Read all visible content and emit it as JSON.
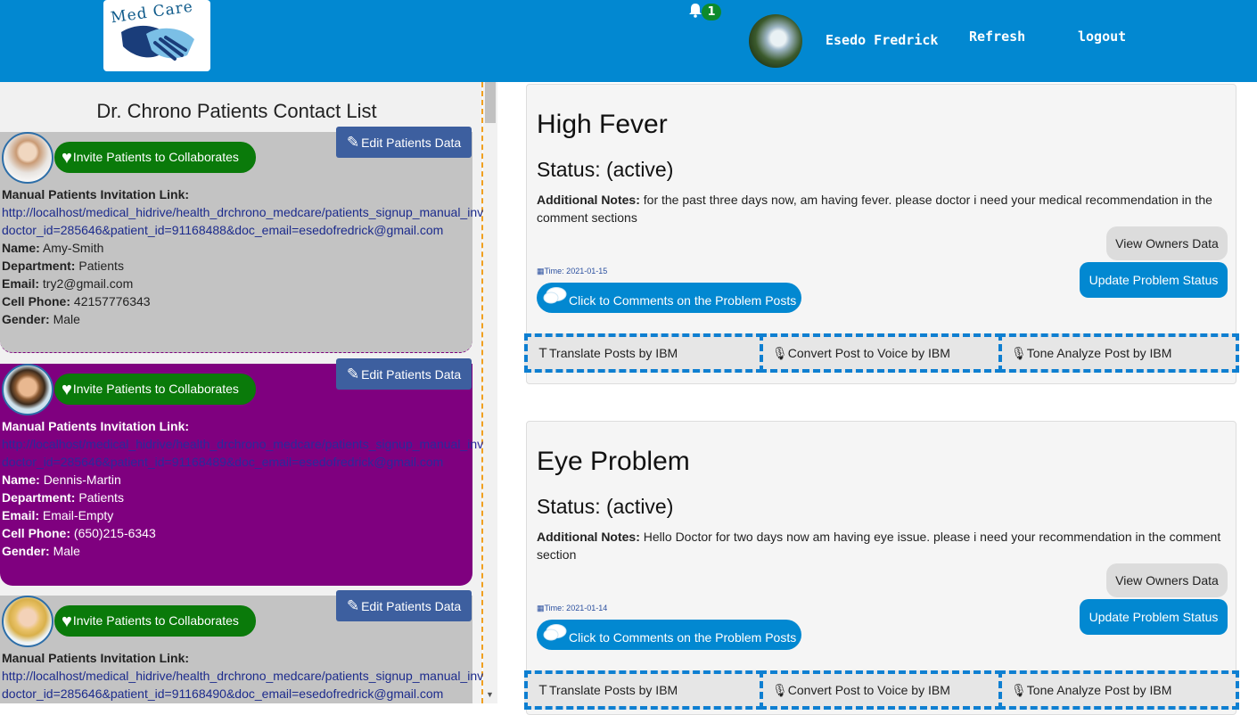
{
  "header": {
    "logo_text": "Med Care",
    "notification_count": "1",
    "user_name": "Esedo Fredrick",
    "refresh_label": "Refresh",
    "logout_label": "logout",
    "colors": {
      "bar": "#0288d1",
      "badge": "#0d8a2c"
    }
  },
  "contacts": {
    "title": "Dr. Chrono Patients Contact List",
    "edit_label": "Edit Patients Data",
    "invite_label": "Invite Patients to Collaborates",
    "link_heading": "Manual Patients Invitation Link:",
    "labels": {
      "name": "Name:",
      "department": "Department:",
      "email": "Email:",
      "phone": "Cell Phone:",
      "gender": "Gender:"
    },
    "patients": [
      {
        "link_line1": "http://localhost/medical_hidrive/health_drchrono_medcare/patients_signup_manual_inv",
        "link_line2": "doctor_id=285646&patient_id=91168488&doc_email=esedofredrick@gmail.com",
        "name": "Amy-Smith",
        "department": "Patients",
        "email": "try2@gmail.com",
        "phone": "42157776343",
        "gender": "Male"
      },
      {
        "link_line1": "http://localhost/medical_hidrive/health_drchrono_medcare/patients_signup_manual_inv",
        "link_line2": "doctor_id=285646&patient_id=91168489&doc_email=esedofredrick@gmail.com",
        "name": "Dennis-Martin",
        "department": "Patients",
        "email": "Email-Empty",
        "phone": "(650)215-6343",
        "gender": "Male"
      },
      {
        "link_line1": "http://localhost/medical_hidrive/health_drchrono_medcare/patients_signup_manual_inv",
        "link_line2": "doctor_id=285646&patient_id=91168490&doc_email=esedofredrick@gmail.com"
      }
    ]
  },
  "posts": {
    "notes_label": "Additional Notes:",
    "view_owner_label": "View Owners Data",
    "update_label": "Update Problem Status",
    "comment_label": "Click to Comments on the Problem Posts",
    "translate_label": "Translate Posts by IBM",
    "voice_label": "Convert Post to Voice by IBM",
    "tone_label": "Tone Analyze Post by IBM",
    "items": [
      {
        "title": "High Fever",
        "status": "Status: (active)",
        "notes": "for the past three days now, am having fever. please doctor i need your medical recommendation in the comment sections",
        "time": "Time: 2021-01-15"
      },
      {
        "title": "Eye Problem",
        "status": "Status: (active)",
        "notes": "Hello Doctor for two days now am having eye issue. please i need your recommendation in the comment section",
        "time": "Time: 2021-01-14"
      }
    ]
  }
}
